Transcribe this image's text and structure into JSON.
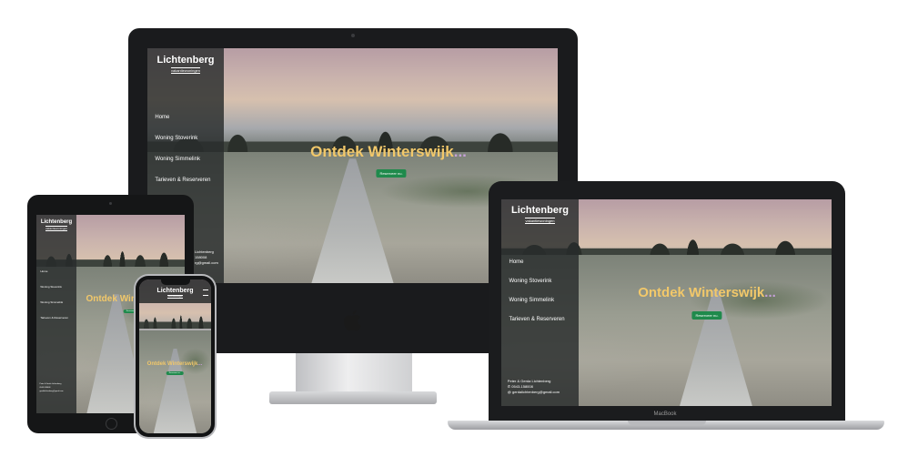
{
  "site": {
    "brand": "Lichtenberg",
    "tagline": "vakantiewoningen",
    "nav": [
      "Home",
      "Woning Stoverink",
      "Woning Simmelink",
      "Tarieven & Reserveren"
    ],
    "headline": "Ontdek Winterswijk",
    "headline_suffix": "...",
    "cta": "Reserveer nu.",
    "contact": {
      "names": "Peter & Gerda Lichtenberg",
      "phone": "0543-158008",
      "email": "gerdalichtenberg@gmail.com"
    },
    "imac_contact_partial": {
      "names": "Lichtenberg",
      "phone": "158008",
      "email": "rg@gmail.com"
    }
  },
  "devices": {
    "laptop_label": "MacBook",
    "apple_logo_icon": "apple-logo-icon"
  },
  "colors": {
    "headline": "#f2c86a",
    "cta_bg": "#1f8a4c",
    "sidebar_bg": "rgba(40,44,44,0.82)",
    "device_bezel": "#1a1b1d"
  }
}
